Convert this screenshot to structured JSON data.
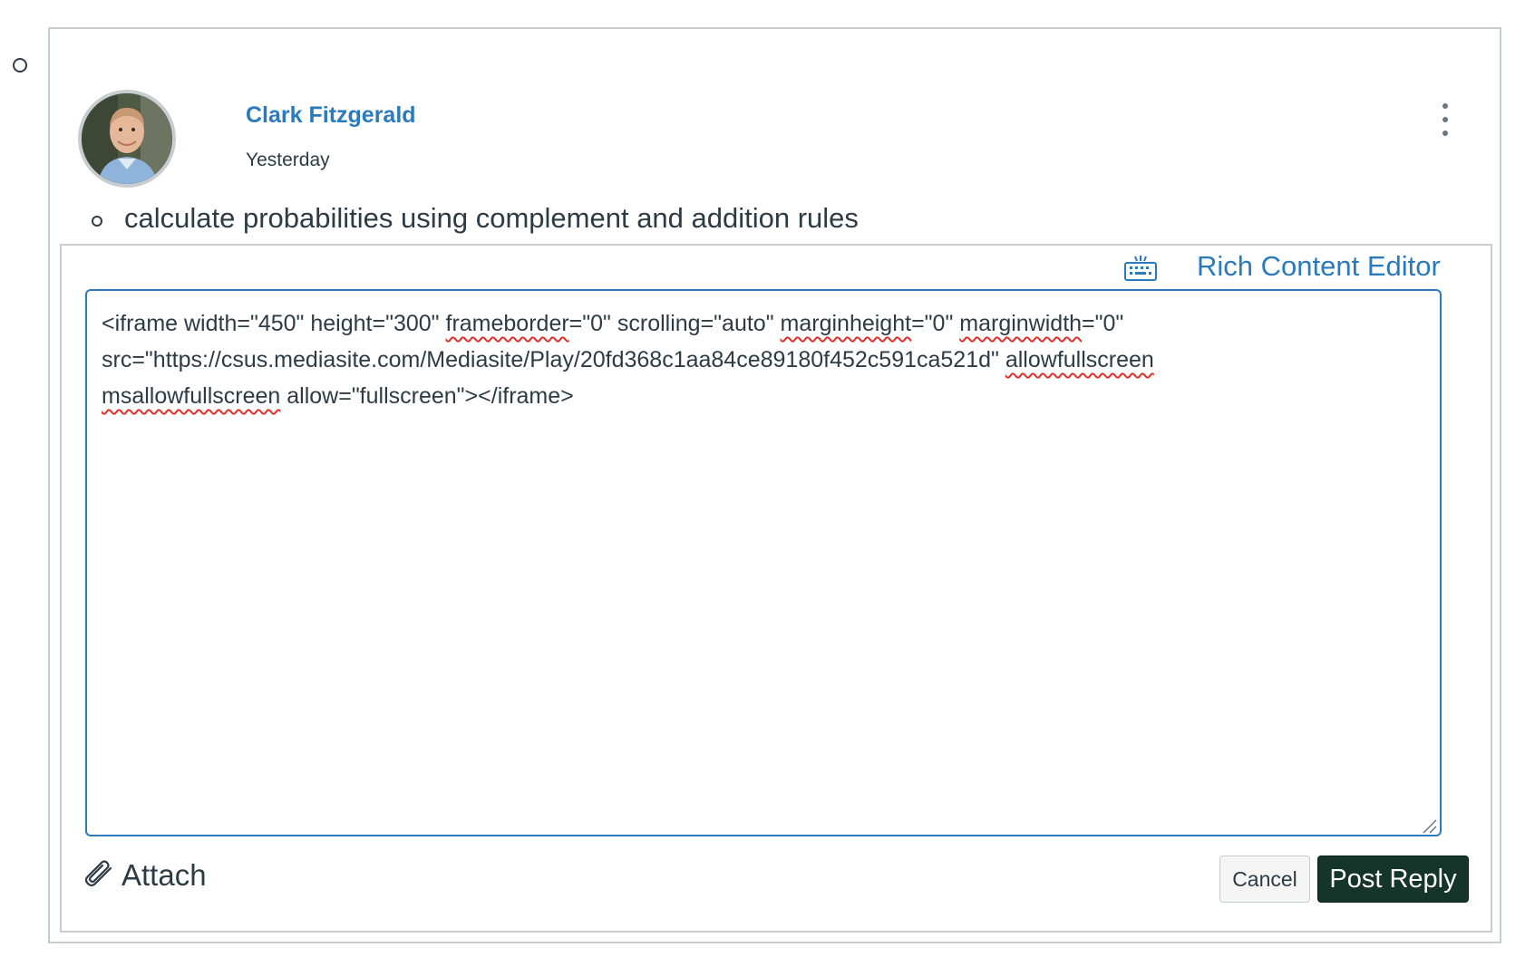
{
  "entry": {
    "author": "Clark Fitzgerald",
    "date": "Yesterday",
    "outcome": "calculate probabilities using complement and addition rules"
  },
  "editor": {
    "rce_link": "Rich Content Editor",
    "lines": [
      [
        {
          "t": "<iframe width=\"450\" height=\"300\" "
        },
        {
          "t": "frameborder",
          "spell": true
        },
        {
          "t": "=\"0\" scrolling=\"auto\" "
        },
        {
          "t": "marginheight",
          "spell": true
        },
        {
          "t": "=\"0\" "
        },
        {
          "t": "marginwidth",
          "spell": true
        },
        {
          "t": "=\"0\""
        }
      ],
      [
        {
          "t": "src=\"https://csus.mediasite.com/Mediasite/Play/20fd368c1aa84ce89180f452c591ca521d\" "
        },
        {
          "t": "allowfullscreen",
          "spell": true
        }
      ],
      [
        {
          "t": "msallowfullscreen",
          "spell": true
        },
        {
          "t": " allow=\"fullscreen\"></iframe>"
        }
      ]
    ]
  },
  "actions": {
    "attach": "Attach",
    "cancel": "Cancel",
    "post": "Post Reply"
  },
  "colors": {
    "link": "#2b7abc",
    "post_button": "#15342a",
    "spellcheck": "#e0302a"
  },
  "icons": [
    "keyboard-icon",
    "kebab-menu-icon",
    "paperclip-icon",
    "resize-handle-icon"
  ]
}
